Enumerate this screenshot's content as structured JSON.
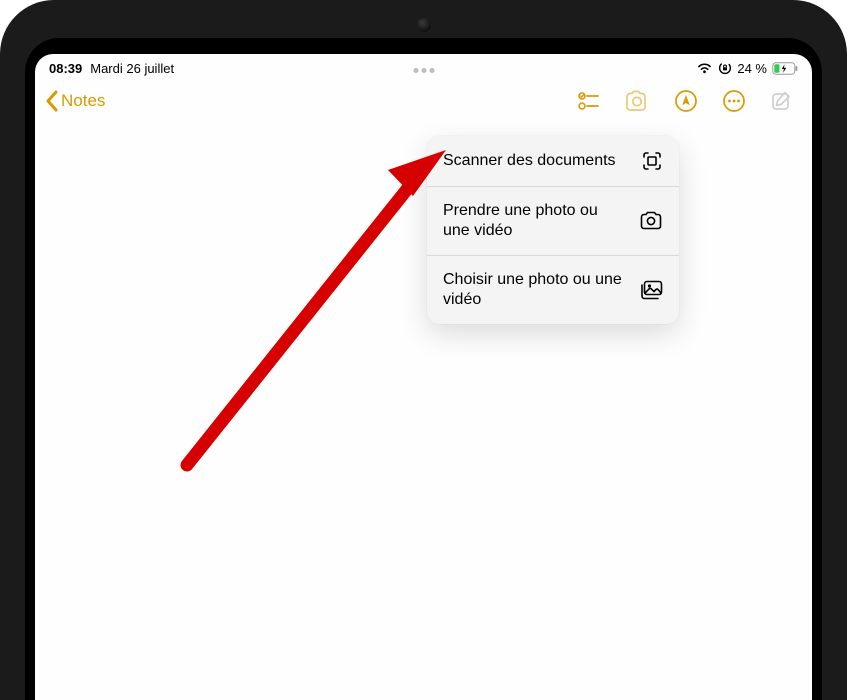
{
  "status": {
    "time": "08:39",
    "date": "Mardi 26 juillet",
    "battery_text": "24 %"
  },
  "nav": {
    "back_label": "Notes"
  },
  "popover": {
    "items": [
      {
        "label": "Scanner des documents"
      },
      {
        "label": "Prendre une photo ou une vidéo"
      },
      {
        "label": "Choisir une photo ou une vidéo"
      }
    ]
  }
}
